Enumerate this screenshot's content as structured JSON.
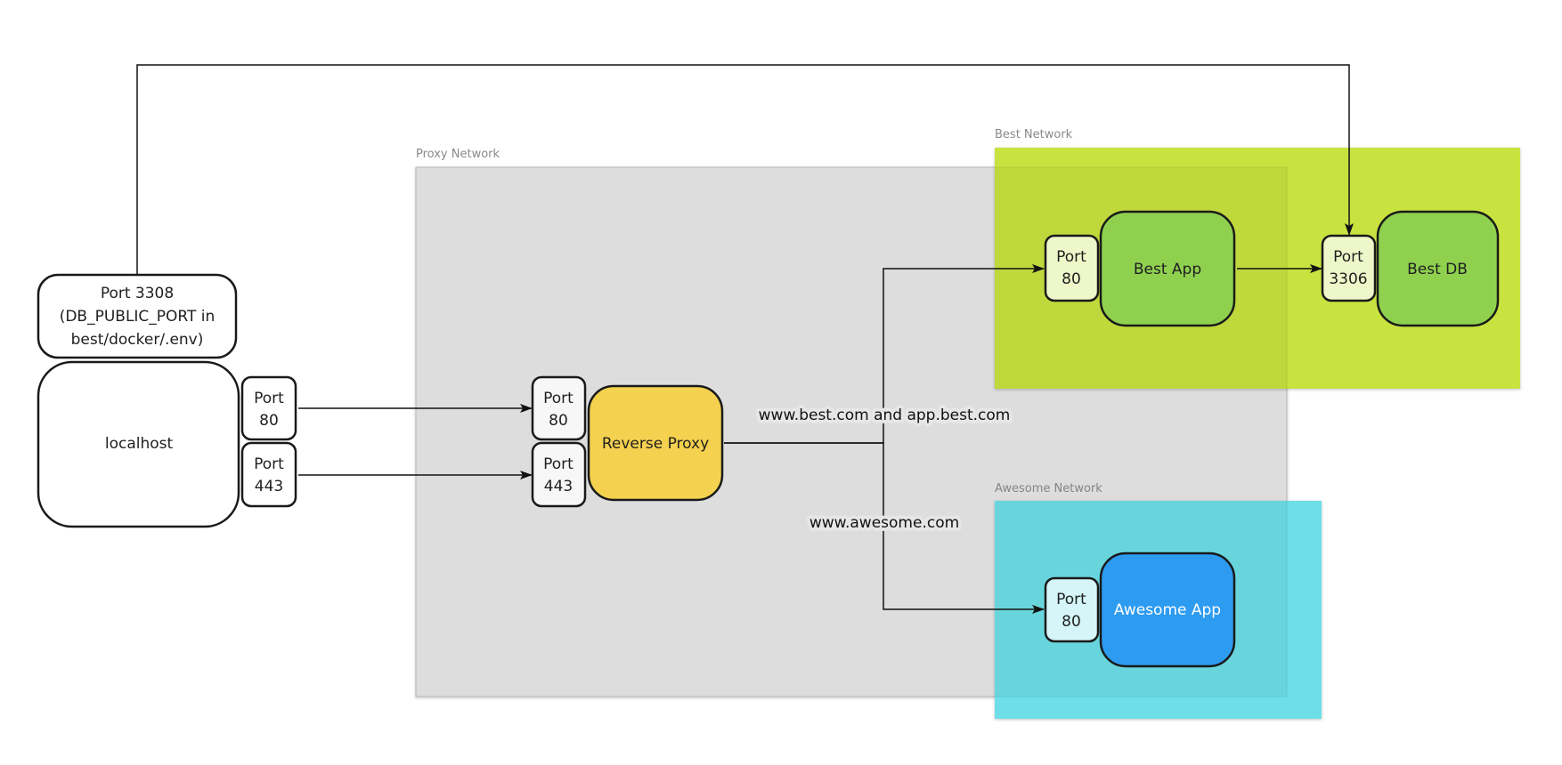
{
  "colors": {
    "proxy_network": "#e6e6e6",
    "best_network": "#c7e23a",
    "awesome_network": "#6adfe8",
    "best_nodes": "#8fd14f",
    "awesome_app": "#2d9bf0",
    "reverse_proxy": "#f4d14e"
  },
  "networks": {
    "proxy": "Proxy Network",
    "best": "Best Network",
    "awesome": "Awesome Network"
  },
  "host": {
    "label": "localhost",
    "db_port": [
      "Port 3308",
      "(DB_PUBLIC_PORT in",
      "best/docker/.env)"
    ],
    "port80": [
      "Port",
      "80"
    ],
    "port443": [
      "Port",
      "443"
    ]
  },
  "proxy": {
    "label": "Reverse Proxy",
    "port80": [
      "Port",
      "80"
    ],
    "port443": [
      "Port",
      "443"
    ]
  },
  "best": {
    "app": "Best App",
    "app_port": [
      "Port",
      "80"
    ],
    "db": "Best DB",
    "db_port": [
      "Port",
      "3306"
    ]
  },
  "awesome": {
    "app": "Awesome App",
    "app_port": [
      "Port",
      "80"
    ]
  },
  "routes": {
    "best": "www.best.com and app.best.com",
    "awesome": "www.awesome.com"
  }
}
